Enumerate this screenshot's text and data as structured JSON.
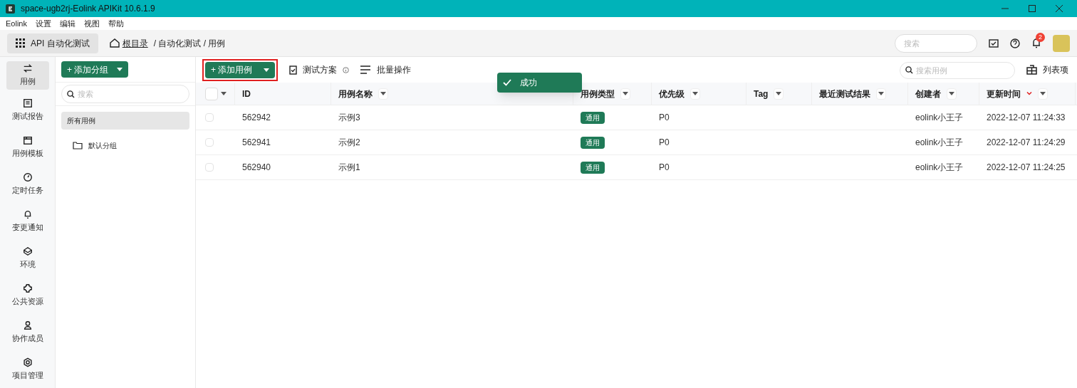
{
  "window": {
    "title": "space-ugb2rj-Eolink APIKit 10.6.1.9"
  },
  "menu": [
    "Eolink",
    "设置",
    "编辑",
    "视图",
    "帮助"
  ],
  "topbar": {
    "module": "API 自动化测试",
    "breadcrumb": [
      {
        "label": "根目录",
        "link": true
      },
      {
        "label": "/ 自动化测试 / 用例",
        "link": false
      }
    ],
    "search_placeholder": "搜索",
    "notification_count": "2"
  },
  "nav": [
    {
      "kind": "swap",
      "label": "用例",
      "selected": true
    },
    {
      "kind": "report",
      "label": "测试报告",
      "selected": false
    },
    {
      "kind": "template",
      "label": "用例模板",
      "selected": false
    },
    {
      "kind": "timer",
      "label": "定时任务",
      "selected": false
    },
    {
      "kind": "bell",
      "label": "变更通知",
      "selected": false
    },
    {
      "kind": "env",
      "label": "环境",
      "selected": false
    },
    {
      "kind": "puzzle",
      "label": "公共资源",
      "selected": false
    },
    {
      "kind": "user",
      "label": "协作成员",
      "selected": false
    },
    {
      "kind": "gear",
      "label": "项目管理",
      "selected": false
    }
  ],
  "groups": {
    "add_button": "+ 添加分组",
    "search_placeholder": "搜索",
    "items": [
      {
        "label": "所有用例",
        "selected": true,
        "folder": false
      },
      {
        "label": "默认分组",
        "selected": false,
        "folder": true
      }
    ]
  },
  "toolbar": {
    "add_button": "+ 添加用例",
    "plan": "测试方案",
    "batch": "批量操作",
    "search_placeholder": "搜索用例",
    "columns_button": "列表项"
  },
  "toast": {
    "text": "成功"
  },
  "table": {
    "all_checked": false,
    "columns": [
      {
        "label": "ID",
        "filter": false,
        "sorted": false
      },
      {
        "label": "用例名称",
        "filter": true,
        "sorted": false
      },
      {
        "label": "用例类型",
        "filter": true,
        "sorted": false
      },
      {
        "label": "优先级",
        "filter": true,
        "sorted": false
      },
      {
        "label": "Tag",
        "filter": true,
        "sorted": false
      },
      {
        "label": "最近测试结果",
        "filter": true,
        "sorted": false
      },
      {
        "label": "创建者",
        "filter": true,
        "sorted": false
      },
      {
        "label": "更新时间",
        "filter": true,
        "sorted": true
      }
    ],
    "rows": [
      {
        "checked": false,
        "cells": [
          "562942",
          "示例3",
          "通用",
          "P0",
          "",
          "",
          "eolink小王子",
          "2022-12-07 11:24:33"
        ]
      },
      {
        "checked": false,
        "cells": [
          "562941",
          "示例2",
          "通用",
          "P0",
          "",
          "",
          "eolink小王子",
          "2022-12-07 11:24:29"
        ]
      },
      {
        "checked": false,
        "cells": [
          "562940",
          "示例1",
          "通用",
          "P0",
          "",
          "",
          "eolink小王子",
          "2022-12-07 11:24:25"
        ]
      }
    ]
  }
}
